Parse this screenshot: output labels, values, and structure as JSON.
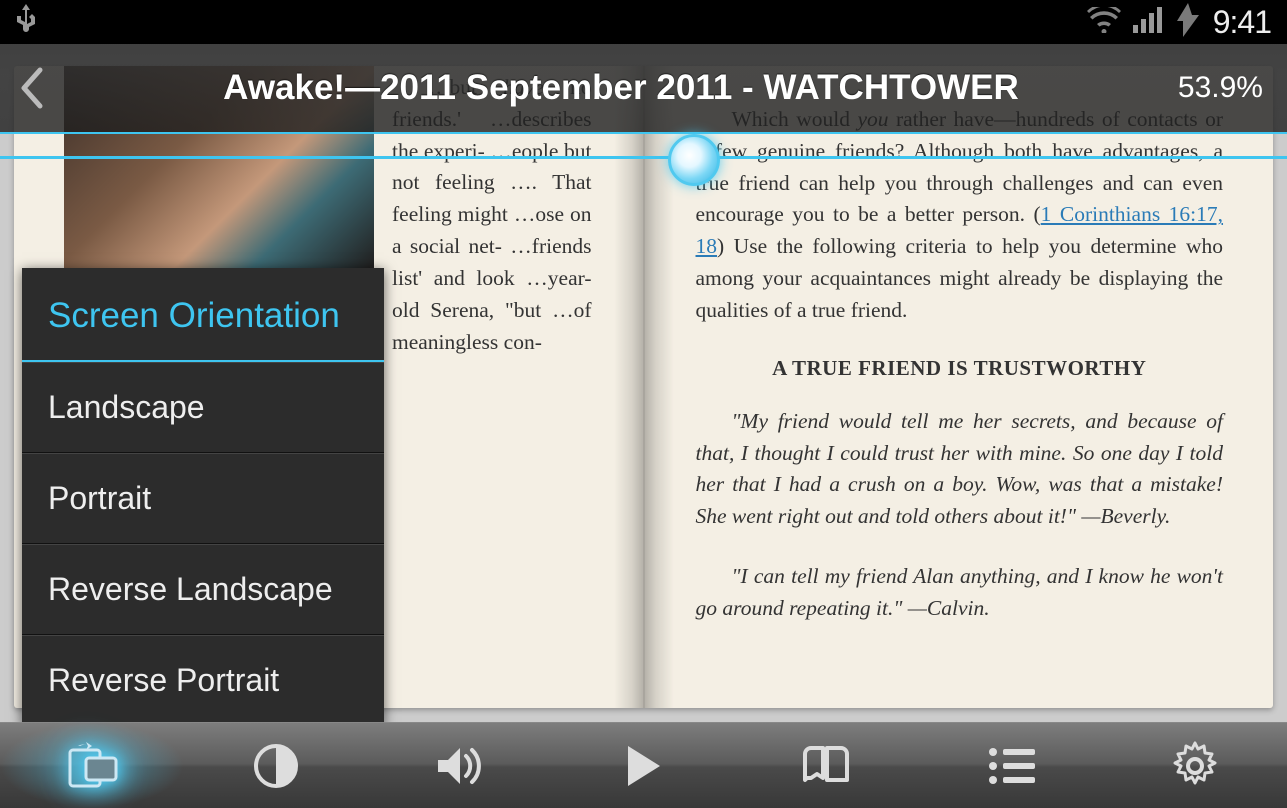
{
  "status": {
    "time": "9:41"
  },
  "header": {
    "title": "Awake!—2011 September 2011 - WATCHTOWER",
    "percent": "53.9%"
  },
  "page_left": {
    "para1_a": "…but ",
    "para1_b": "have",
    "para1_c": " no friends.' …describes the experi- …eople but not feeling …. That feeling might …ose on a social net- …friends list' and look …year-old Serena, \"but …of meaningless con-"
  },
  "page_right": {
    "para1_a": "Which would ",
    "para1_b": "you",
    "para1_c": " rather have—hundreds of contacts or a few genuine friends? Although both have advantages, a true friend can help you through challenges and can even encourage you to be a better person. (",
    "para1_link": "1 Corinthians 16:17, 18",
    "para1_d": ") Use the following criteria to help you determine who among your acquaintances might already be displaying the qualities of a true friend.",
    "heading": "A TRUE FRIEND IS TRUSTWORTHY",
    "quote1": "\"My friend would tell me her secrets, and because of that, I thought I could trust her with mine. So one day I told her that I had a crush on a boy. Wow, was that a mistake! She went right out and told others about it!\" —Beverly.",
    "quote2": "\"I can tell my friend Alan anything, and I know he won't go around repeating it.\" —Calvin."
  },
  "popup": {
    "header": "Screen Orientation",
    "items": [
      "Landscape",
      "Portrait",
      "Reverse Landscape",
      "Reverse Portrait"
    ]
  },
  "toolbar": {
    "buttons": [
      "orientation",
      "brightness",
      "volume",
      "play",
      "bookmarks",
      "contents",
      "settings"
    ]
  }
}
